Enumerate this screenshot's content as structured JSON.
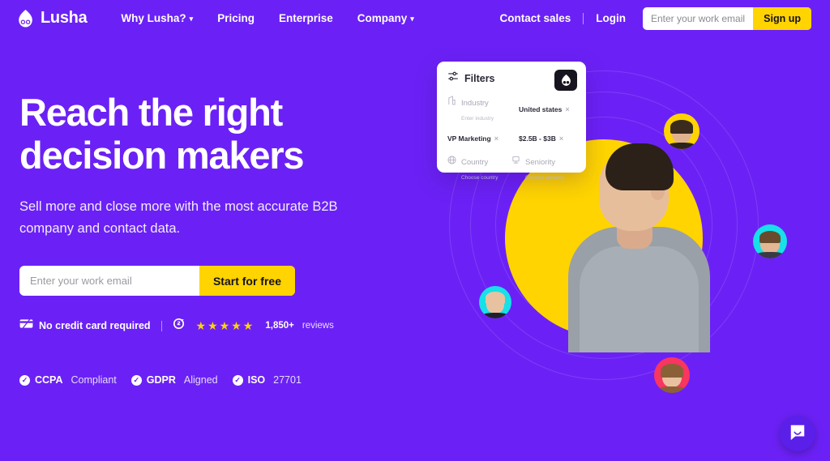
{
  "brand": {
    "name": "Lusha",
    "purple": "#6B21F5",
    "yellow": "#FFD400",
    "logo_icon": "lusha-droplet-icon"
  },
  "nav": {
    "links": [
      {
        "label": "Why Lusha?",
        "has_caret": true
      },
      {
        "label": "Pricing",
        "has_caret": false
      },
      {
        "label": "Enterprise",
        "has_caret": false
      },
      {
        "label": "Company",
        "has_caret": true
      }
    ],
    "contact_sales": "Contact sales",
    "login": "Login",
    "signup": {
      "placeholder": "Enter your work email",
      "value": "",
      "button": "Sign up"
    }
  },
  "hero": {
    "headline_line1": "Reach the right",
    "headline_line2": "decision makers",
    "subhead_line1": "Sell more and close more with the most accurate B2B",
    "subhead_line2": "company and contact data.",
    "cta": {
      "placeholder": "Enter your work email",
      "value": "",
      "button": "Start for free"
    },
    "trust": {
      "no_card": "No credit card required",
      "g2_icon": "g2-logo-icon",
      "stars": 5,
      "reviews_count": "1,850+",
      "reviews_word": "reviews"
    }
  },
  "compliance": [
    {
      "strong": "CCPA",
      "soft": "Compliant"
    },
    {
      "strong": "GDPR",
      "soft": "Aligned"
    },
    {
      "strong": "ISO",
      "soft": "27701"
    }
  ],
  "filter_card": {
    "title": "Filters",
    "badge_icon": "lusha-app-icon",
    "filters_icon": "sliders-icon",
    "fields": [
      {
        "icon": "building-icon",
        "label": "Industry",
        "sub": "Enter industry"
      },
      {
        "icon": "globe-icon",
        "label": "Country",
        "sub": "Choose country"
      },
      {
        "icon": "seniority-icon",
        "label": "Seniority",
        "sub": "Choose seniority"
      }
    ],
    "tags": [
      {
        "text": "United states",
        "remove": "×"
      },
      {
        "text": "VP Marketing",
        "remove": "×"
      },
      {
        "text": "$2.5B - $3B",
        "remove": "×"
      }
    ]
  },
  "visual": {
    "avatars": [
      {
        "name": "avatar-top-right",
        "bg": "#FFD400"
      },
      {
        "name": "avatar-right",
        "bg": "#18E0E8"
      },
      {
        "name": "avatar-left",
        "bg": "#18E0E8"
      },
      {
        "name": "avatar-bottom",
        "bg": "#F8365F"
      }
    ],
    "hero_person": "person-photo"
  },
  "chat": {
    "icon": "chat-bubble-icon"
  }
}
